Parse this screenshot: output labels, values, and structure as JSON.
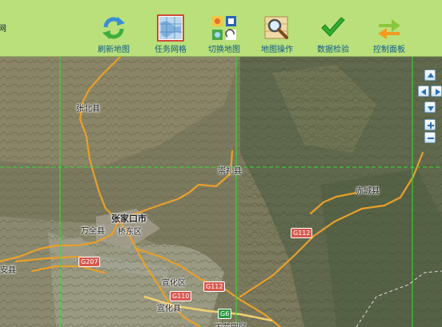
{
  "app": {
    "title_fragment": "网"
  },
  "toolbar": {
    "items": [
      {
        "label": "刷新地图",
        "icon": "refresh-icon"
      },
      {
        "label": "任务网格",
        "icon": "grid-map-icon"
      },
      {
        "label": "切换地图",
        "icon": "switch-map-icon"
      },
      {
        "label": "地图操作",
        "icon": "magnifier-map-icon"
      },
      {
        "label": "数据检验",
        "icon": "checkmark-icon"
      },
      {
        "label": "控制面板",
        "icon": "swap-arrows-icon"
      }
    ]
  },
  "map": {
    "type": "satellite",
    "places": [
      {
        "name": "张北县"
      },
      {
        "name": "崇礼县"
      },
      {
        "name": "赤城县"
      },
      {
        "name": "张家口市"
      },
      {
        "name": "万全县"
      },
      {
        "name": "桥东区"
      },
      {
        "name": "宣化区"
      },
      {
        "name": "宣化县"
      },
      {
        "name": "安县"
      },
      {
        "name": "下花园区"
      }
    ],
    "road_shields": [
      {
        "label": "G112"
      },
      {
        "label": "G207"
      },
      {
        "label": "G112"
      },
      {
        "label": "G110"
      },
      {
        "label": "G6"
      }
    ],
    "grid_color": "#33dd33",
    "road_color": "#e8a02a"
  },
  "controls": {
    "pan_up": "pan-up-icon",
    "pan_left": "pan-left-icon",
    "pan_right": "pan-right-icon",
    "pan_down": "pan-down-icon",
    "zoom_in": "+",
    "zoom_out": "−"
  }
}
